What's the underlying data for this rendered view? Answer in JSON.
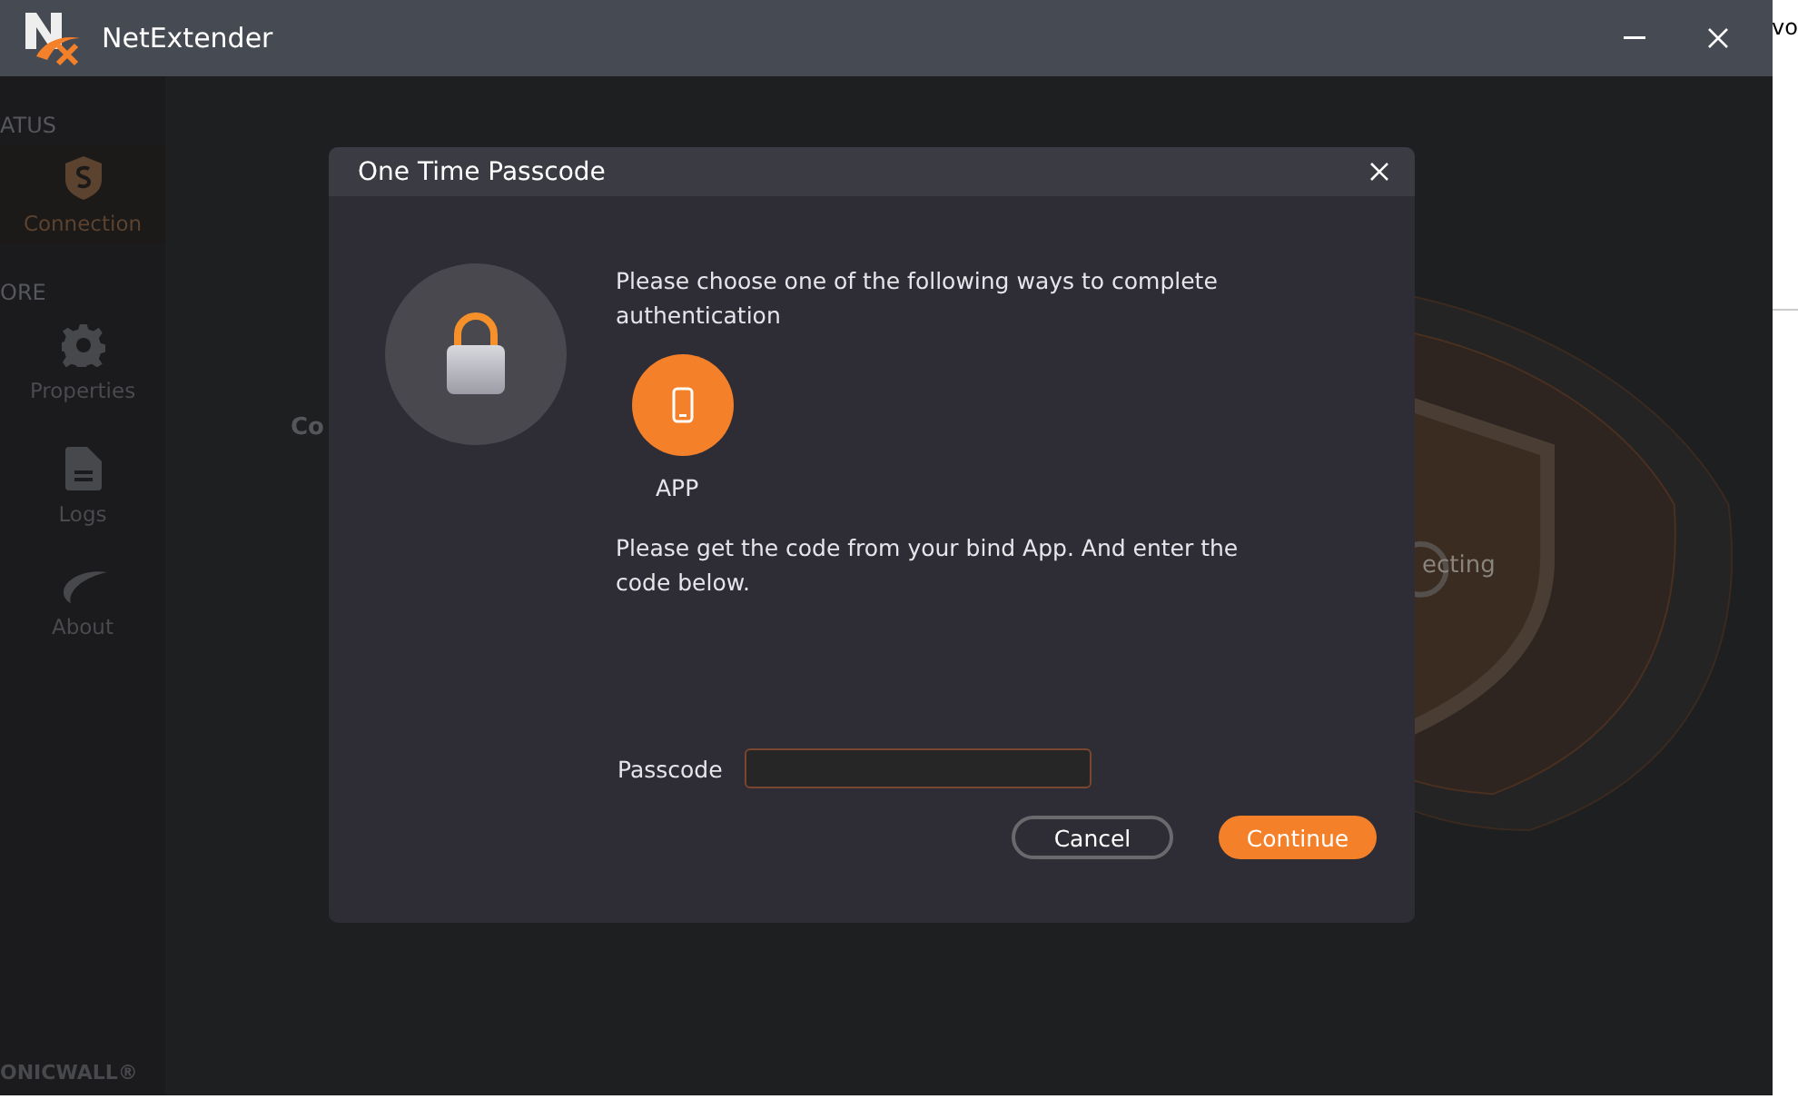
{
  "window": {
    "title": "NetExtender"
  },
  "sidebar": {
    "items": [
      {
        "kind": "section",
        "label": "ATUS"
      },
      {
        "kind": "nav",
        "label": "Connection",
        "selected": true
      },
      {
        "kind": "section",
        "label": "ORE"
      },
      {
        "kind": "nav",
        "label": "Properties",
        "selected": false
      },
      {
        "kind": "nav",
        "label": "Logs",
        "selected": false
      },
      {
        "kind": "nav",
        "label": "About",
        "selected": false
      }
    ],
    "brand": "ONICWALL®"
  },
  "main": {
    "heading": "Co",
    "status": "ecting"
  },
  "dialog": {
    "title": "One Time Passcode",
    "intro": "Please choose one of the following ways to complete authentication",
    "methods": [
      {
        "label": "APP",
        "selected": true
      }
    ],
    "instructions": "Please get the code from your bind App. And enter the code below.",
    "field": {
      "label": "Passcode"
    },
    "buttons": [
      {
        "kind": "secondary",
        "label": "Cancel"
      },
      {
        "kind": "primary",
        "label": "Continue"
      }
    ]
  },
  "background_window": {
    "text": "vo"
  }
}
